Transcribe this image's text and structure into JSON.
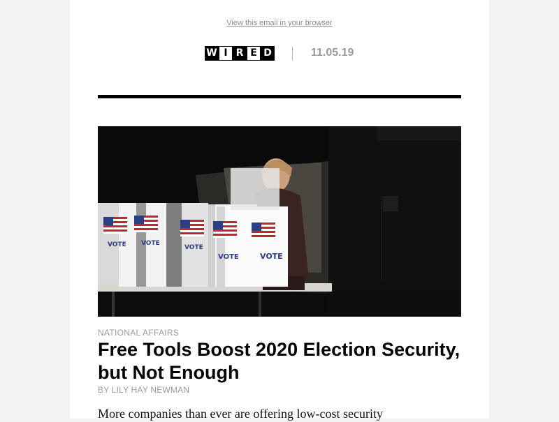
{
  "header": {
    "browser_link": "View this email in your browser",
    "logo_letters": [
      "W",
      "I",
      "R",
      "E",
      "D"
    ],
    "date": "11.05.19"
  },
  "hero": {
    "booth_label": "VOTE"
  },
  "article": {
    "category": "NATIONAL AFFAIRS",
    "headline": "Free Tools Boost 2020 Election Security, but Not Enough",
    "byline": "BY LILY HAY NEWMAN",
    "dek": "More companies than ever are offering low-cost security"
  }
}
